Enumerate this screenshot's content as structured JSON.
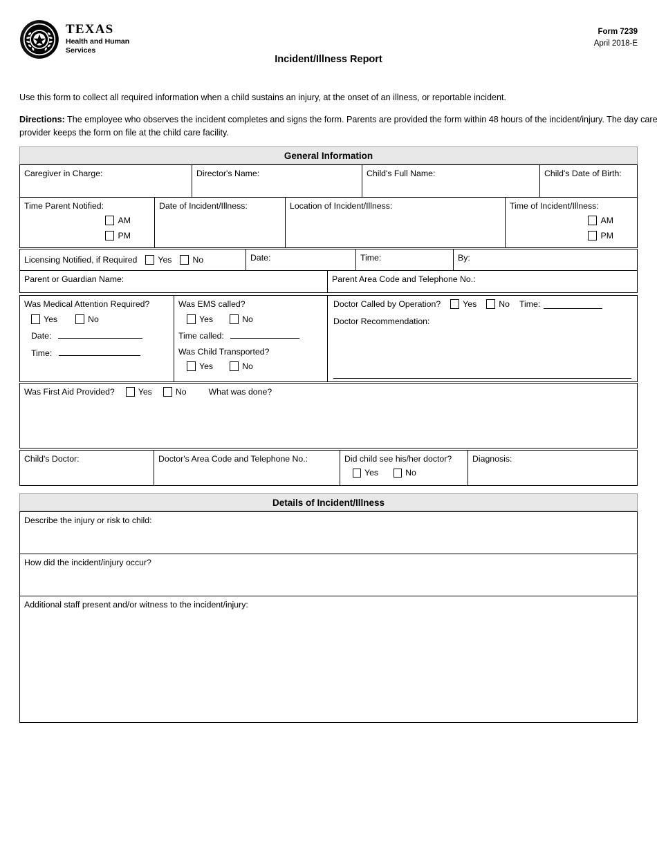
{
  "header": {
    "agency_name": "TEXAS",
    "agency_sub_line1": "Health and Human",
    "agency_sub_line2": "Services",
    "seal_icon": "texas-hhs-seal-icon",
    "form_number": "Form 7239",
    "form_date": "April 2018-E",
    "document_title": "Incident/Illness Report"
  },
  "intro": {
    "purpose": "Use this form to collect all required information when a child sustains an injury, at the onset of an illness, or reportable incident.",
    "directions_label": "Directions:",
    "directions_text": " The employee who observes the incident completes and signs the form. Parents are provided the form within 48 hours of the incident/injury. The day care provider keeps the form on file at the child care facility."
  },
  "sections": {
    "general_information": "General Information",
    "details": "Details of Incident/Illness"
  },
  "general": {
    "caregiver_in_charge": "Caregiver in Charge:",
    "directors_name": "Director's Name:",
    "childs_full_name": "Child's Full Name:",
    "childs_date_of_birth": "Child's Date of Birth:",
    "time_parent_notified": "Time Parent Notified:",
    "date_of_incident": "Date of Incident/Illness:",
    "location_of_incident": "Location of Incident/Illness:",
    "time_of_incident": "Time of Incident/Illness:",
    "am": "AM",
    "pm": "PM",
    "licensing_notified": "Licensing Notified, if Required",
    "yes": "Yes",
    "no": "No",
    "date": "Date:",
    "time": "Time:",
    "by": "By:",
    "parent_or_guardian_name": "Parent or Guardian Name:",
    "parent_phone": "Parent Area Code and Telephone No.:",
    "was_medical_attention_required": "Was Medical Attention Required?",
    "med_date": "Date:",
    "med_time": "Time:",
    "was_ems_called": "Was EMS called?",
    "time_called": "Time called:",
    "was_child_transported": "Was Child Transported?",
    "doctor_called_by_operation": "Doctor Called by Operation?",
    "doctor_time": "Time:",
    "doctor_recommendation": "Doctor Recommendation:",
    "was_first_aid_provided": "Was First Aid Provided?",
    "what_was_done": "What was done?",
    "childs_doctor": "Child's Doctor:",
    "doctors_phone": "Doctor's Area Code and Telephone No.:",
    "did_child_see_doctor": "Did child see his/her doctor?",
    "diagnosis": "Diagnosis:"
  },
  "details": {
    "describe_injury": "Describe the injury or risk to child:",
    "how_did_occur": "How did the incident/injury occur?",
    "additional_staff": "Additional staff present and/or witness to the incident/injury:"
  }
}
